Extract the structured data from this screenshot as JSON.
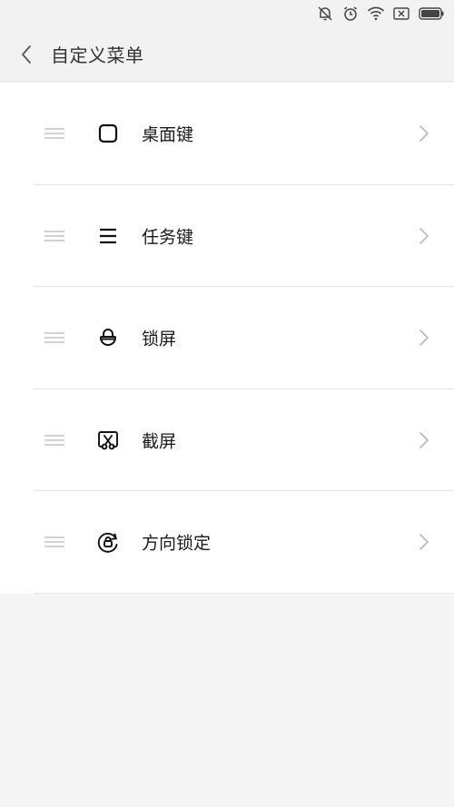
{
  "status_bar": {
    "icons": [
      "mute-notifications-icon",
      "alarm-icon",
      "wifi-icon",
      "close-box-icon",
      "battery-icon"
    ]
  },
  "header": {
    "back_icon": "chevron-left-icon",
    "title": "自定义菜单"
  },
  "menu_items": [
    {
      "label": "桌面键",
      "icon": "rounded-square-icon"
    },
    {
      "label": "任务键",
      "icon": "menu-lines-icon"
    },
    {
      "label": "锁屏",
      "icon": "lock-icon"
    },
    {
      "label": "截屏",
      "icon": "screenshot-scissors-icon"
    },
    {
      "label": "方向锁定",
      "icon": "rotation-lock-icon"
    }
  ],
  "colors": {
    "background": "#f5f5f5",
    "list_background": "#ffffff",
    "divider": "#e6e6e6",
    "text": "#1a1a1a",
    "secondary_icon": "#b8b8b8"
  }
}
